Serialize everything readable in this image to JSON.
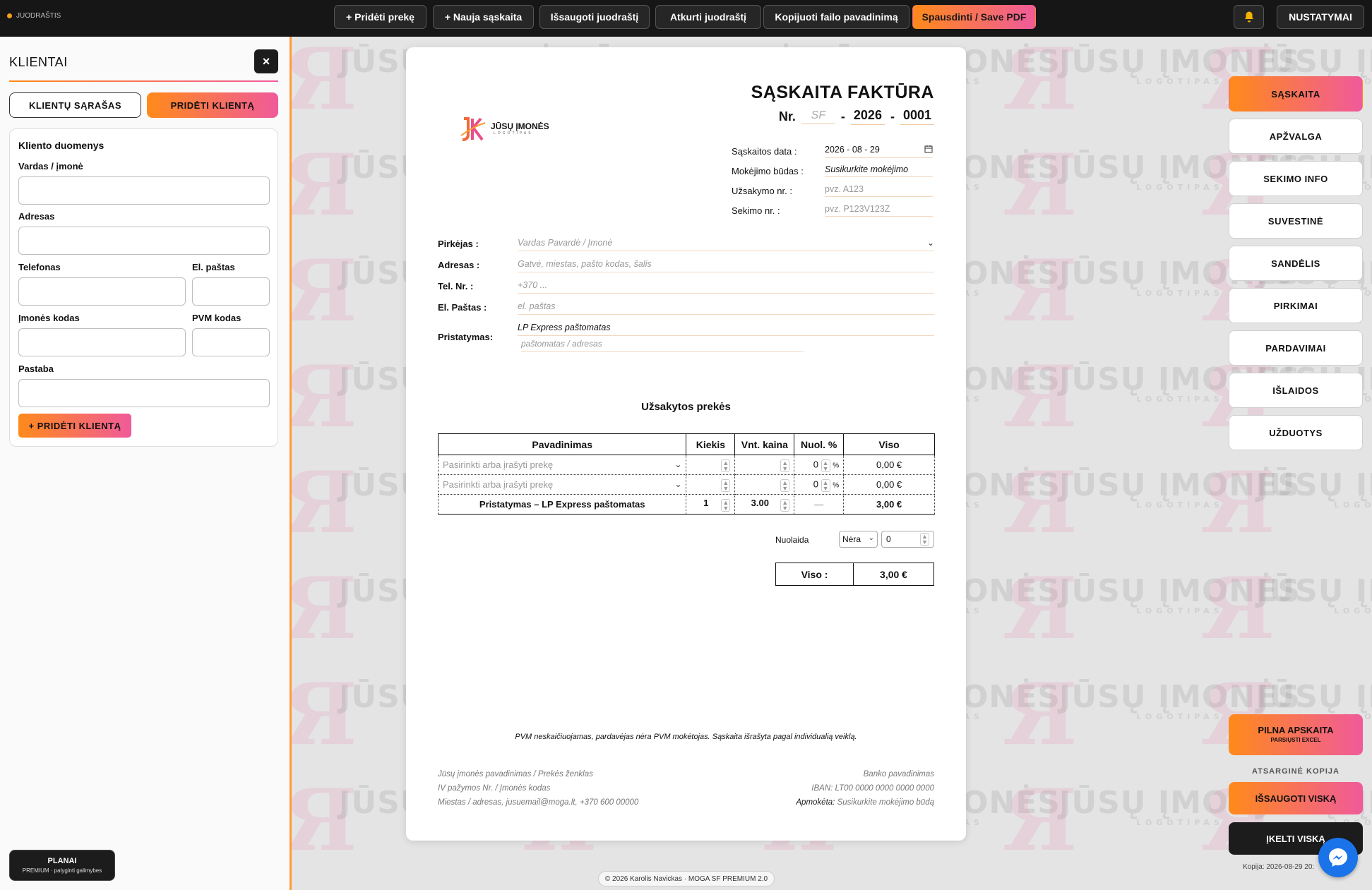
{
  "topbar": {
    "draft_status": "JUODRAŠTIS",
    "buttons": {
      "add_item": "+ Pridėti prekę",
      "new_invoice": "+ Nauja sąskaita",
      "save_draft": "Išsaugoti juodraštį",
      "restore_draft": "Atkurti juodraštį",
      "copy_filename": "Kopijuoti failo pavadinimą",
      "print_pdf": "Spausdinti / Save PDF",
      "settings": "NUSTATYMAI"
    }
  },
  "watermark": {
    "text": "JŪSŲ ĮMONĖS",
    "sub": "LOGOTIPAS"
  },
  "clients_panel": {
    "title": "KLIENTAI",
    "close": "×",
    "tab_list": "KLIENTŲ SĄRAŠAS",
    "tab_add": "PRIDĖTI KLIENTĄ",
    "section_title": "Kliento duomenys",
    "labels": {
      "name": "Vardas / įmonė",
      "address": "Adresas",
      "phone": "Telefonas",
      "email": "El. paštas",
      "company_code": "Įmonės kodas",
      "vat_code": "PVM kodas",
      "note": "Pastaba"
    },
    "add_button": "+ PRIDĖTI KLIENTĄ"
  },
  "plans": {
    "title": "PLANAI",
    "sub": "PREMIUM · palyginti galimybes"
  },
  "invoice": {
    "title": "SĄSKAITA FAKTŪRA",
    "nr_label": "Nr.",
    "nr_prefix": "SF",
    "nr_dash": "-",
    "nr_year": "2026",
    "nr_number": "0001",
    "logo_text": "JŪSŲ ĮMONĖS",
    "logo_sub": "LOGOTIPAS",
    "meta": {
      "date_label": "Sąskaitos data :",
      "date_value": "2026 - 08 - 29",
      "payment_label": "Mokėjimo būdas :",
      "payment_value": "Susikurkite mokėjimo",
      "order_label": "Užsakymo nr. :",
      "order_placeholder": "pvz. A123",
      "tracking_label": "Sekimo nr. :",
      "tracking_placeholder": "pvz. P123V123Z"
    },
    "buyer": {
      "buyer_label": "Pirkėjas :",
      "buyer_placeholder": "Vardas Pavardė / Įmonė",
      "address_label": "Adresas :",
      "address_placeholder": "Gatvė, miestas, pašto kodas, šalis",
      "phone_label": "Tel. Nr. :",
      "phone_placeholder": "+370 ...",
      "email_label": "El. Paštas :",
      "email_placeholder": "el. paštas",
      "delivery_label": "Pristatymas:",
      "delivery_value": "LP Express paštomatas",
      "delivery_sub_placeholder": "paštomatas / adresas"
    },
    "items_title": "Užsakytos prekės",
    "columns": [
      "Pavadinimas",
      "Kiekis",
      "Vnt. kaina",
      "Nuol. %",
      "Viso"
    ],
    "rows": [
      {
        "name": "Pasirinkti arba įrašyti prekę",
        "qty": "",
        "price": "",
        "disc": "0",
        "disc_unit": "%",
        "total": "0,00 €"
      },
      {
        "name": "Pasirinkti arba įrašyti prekę",
        "qty": "",
        "price": "",
        "disc": "0",
        "disc_unit": "%",
        "total": "0,00 €"
      },
      {
        "name": "Pristatymas – LP Express paštomatas",
        "qty": "1",
        "price": "3.00",
        "disc": "—",
        "disc_unit": "",
        "total": "3,00 €"
      }
    ],
    "discount_label": "Nuolaida",
    "discount_type": "Nėra",
    "discount_value": "0",
    "total_label": "Viso :",
    "total_value": "3,00 €",
    "vat_note": "PVM neskaičiuojamas, pardavėjas nėra PVM mokėtojas. Sąskaita išrašyta pagal individualią veiklą.",
    "footer_left": [
      "Jūsų įmonės pavadinimas / Prekės ženklas",
      "IV pažymos Nr. / Įmonės kodas",
      "Miestas / adresas, jusuemail@moga.lt, +370 600 00000"
    ],
    "footer_right": {
      "bank": "Banko pavadinimas",
      "iban": "IBAN: LT00 0000 0000 0000 0000",
      "paid_label": "Apmokėta:",
      "paid_value": "Susikurkite mokėjimo būdą"
    }
  },
  "copyright": "© 2026 Karolis Navickas · MOGA SF PREMIUM 2.0",
  "right_nav": {
    "items": [
      "SĄSKAITA",
      "APŽVALGA",
      "SEKIMO INFO",
      "SUVESTINĖ",
      "SANDĖLIS",
      "PIRKIMAI",
      "PARDAVIMAI",
      "IŠLAIDOS",
      "UŽDUOTYS"
    ],
    "full_accounting": "PILNA APSKAITA",
    "full_accounting_sub": "PARSIŲSTI EXCEL",
    "backup_label": "ATSARGINĖ KOPIJA",
    "save_all": "IŠSAUGOTI VISKĄ",
    "load_all": "ĮKELTI VISKĄ",
    "copy_date": "Kopija: 2026-08-29 20:"
  },
  "colors": {
    "accent_orange": "#ff8a1a",
    "accent_pink": "#f05a9a",
    "dark": "#161616"
  }
}
